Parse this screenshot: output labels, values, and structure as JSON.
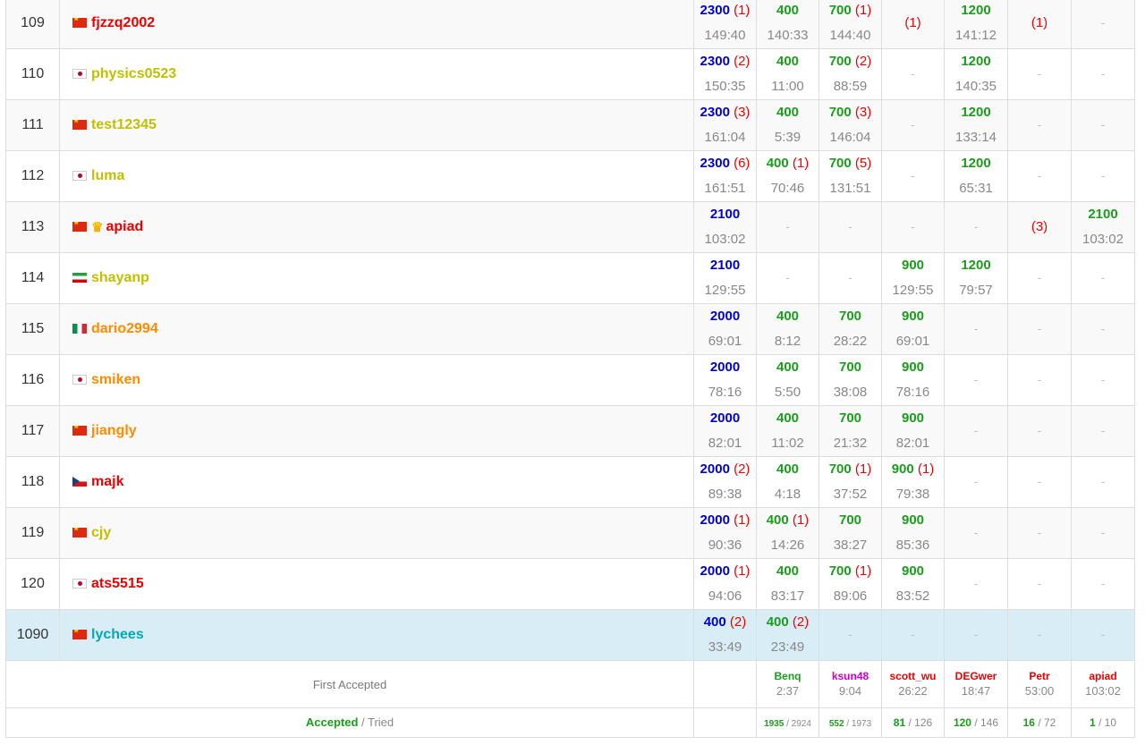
{
  "rows": [
    {
      "rank": "109",
      "flag": "cn",
      "crown": false,
      "user": "fjzzq2002",
      "color": "red",
      "score": "2300",
      "score_pen": "(1)",
      "time": "149:40",
      "tasks": [
        {
          "pts": "400",
          "pen": "",
          "time": "140:33"
        },
        {
          "pts": "700",
          "pen": "(1)",
          "time": "144:40"
        },
        {
          "pts": "",
          "pen": "(1)",
          "time": ""
        },
        {
          "pts": "1200",
          "pen": "",
          "time": "141:12"
        },
        {
          "pts": "",
          "pen": "(1)",
          "time": ""
        },
        {
          "pts": "-",
          "pen": "",
          "time": ""
        }
      ]
    },
    {
      "rank": "110",
      "flag": "jp",
      "crown": false,
      "user": "physics0523",
      "color": "yellow",
      "score": "2300",
      "score_pen": "(2)",
      "time": "150:35",
      "tasks": [
        {
          "pts": "400",
          "pen": "",
          "time": "11:00"
        },
        {
          "pts": "700",
          "pen": "(2)",
          "time": "88:59"
        },
        {
          "pts": "-",
          "pen": "",
          "time": ""
        },
        {
          "pts": "1200",
          "pen": "",
          "time": "140:35"
        },
        {
          "pts": "-",
          "pen": "",
          "time": ""
        },
        {
          "pts": "-",
          "pen": "",
          "time": ""
        }
      ]
    },
    {
      "rank": "111",
      "flag": "cn",
      "crown": false,
      "user": "test12345",
      "color": "yellow",
      "score": "2300",
      "score_pen": "(3)",
      "time": "161:04",
      "tasks": [
        {
          "pts": "400",
          "pen": "",
          "time": "5:39"
        },
        {
          "pts": "700",
          "pen": "(3)",
          "time": "146:04"
        },
        {
          "pts": "-",
          "pen": "",
          "time": ""
        },
        {
          "pts": "1200",
          "pen": "",
          "time": "133:14"
        },
        {
          "pts": "-",
          "pen": "",
          "time": ""
        },
        {
          "pts": "-",
          "pen": "",
          "time": ""
        }
      ]
    },
    {
      "rank": "112",
      "flag": "jp",
      "crown": false,
      "user": "luma",
      "color": "yellow",
      "score": "2300",
      "score_pen": "(6)",
      "time": "161:51",
      "tasks": [
        {
          "pts": "400",
          "pen": "(1)",
          "time": "70:46"
        },
        {
          "pts": "700",
          "pen": "(5)",
          "time": "131:51"
        },
        {
          "pts": "-",
          "pen": "",
          "time": ""
        },
        {
          "pts": "1200",
          "pen": "",
          "time": "65:31"
        },
        {
          "pts": "-",
          "pen": "",
          "time": ""
        },
        {
          "pts": "-",
          "pen": "",
          "time": ""
        }
      ]
    },
    {
      "rank": "113",
      "flag": "cn",
      "crown": true,
      "user": "apiad",
      "color": "red",
      "score": "2100",
      "score_pen": "",
      "time": "103:02",
      "tasks": [
        {
          "pts": "-",
          "pen": "",
          "time": ""
        },
        {
          "pts": "-",
          "pen": "",
          "time": ""
        },
        {
          "pts": "-",
          "pen": "",
          "time": ""
        },
        {
          "pts": "-",
          "pen": "",
          "time": ""
        },
        {
          "pts": "",
          "pen": "(3)",
          "time": ""
        },
        {
          "pts": "2100",
          "pen": "",
          "time": "103:02"
        }
      ]
    },
    {
      "rank": "114",
      "flag": "ir",
      "crown": false,
      "user": "shayanp",
      "color": "yellow",
      "score": "2100",
      "score_pen": "",
      "time": "129:55",
      "tasks": [
        {
          "pts": "-",
          "pen": "",
          "time": ""
        },
        {
          "pts": "-",
          "pen": "",
          "time": ""
        },
        {
          "pts": "900",
          "pen": "",
          "time": "129:55"
        },
        {
          "pts": "1200",
          "pen": "",
          "time": "79:57"
        },
        {
          "pts": "-",
          "pen": "",
          "time": ""
        },
        {
          "pts": "-",
          "pen": "",
          "time": ""
        }
      ]
    },
    {
      "rank": "115",
      "flag": "it",
      "crown": false,
      "user": "dario2994",
      "color": "orange",
      "score": "2000",
      "score_pen": "",
      "time": "69:01",
      "tasks": [
        {
          "pts": "400",
          "pen": "",
          "time": "8:12"
        },
        {
          "pts": "700",
          "pen": "",
          "time": "28:22"
        },
        {
          "pts": "900",
          "pen": "",
          "time": "69:01"
        },
        {
          "pts": "-",
          "pen": "",
          "time": ""
        },
        {
          "pts": "-",
          "pen": "",
          "time": ""
        },
        {
          "pts": "-",
          "pen": "",
          "time": ""
        }
      ]
    },
    {
      "rank": "116",
      "flag": "jp",
      "crown": false,
      "user": "smiken",
      "color": "orange",
      "score": "2000",
      "score_pen": "",
      "time": "78:16",
      "tasks": [
        {
          "pts": "400",
          "pen": "",
          "time": "5:50"
        },
        {
          "pts": "700",
          "pen": "",
          "time": "38:08"
        },
        {
          "pts": "900",
          "pen": "",
          "time": "78:16"
        },
        {
          "pts": "-",
          "pen": "",
          "time": ""
        },
        {
          "pts": "-",
          "pen": "",
          "time": ""
        },
        {
          "pts": "-",
          "pen": "",
          "time": ""
        }
      ]
    },
    {
      "rank": "117",
      "flag": "cn",
      "crown": false,
      "user": "jiangly",
      "color": "orange",
      "score": "2000",
      "score_pen": "",
      "time": "82:01",
      "tasks": [
        {
          "pts": "400",
          "pen": "",
          "time": "11:02"
        },
        {
          "pts": "700",
          "pen": "",
          "time": "21:32"
        },
        {
          "pts": "900",
          "pen": "",
          "time": "82:01"
        },
        {
          "pts": "-",
          "pen": "",
          "time": ""
        },
        {
          "pts": "-",
          "pen": "",
          "time": ""
        },
        {
          "pts": "-",
          "pen": "",
          "time": ""
        }
      ]
    },
    {
      "rank": "118",
      "flag": "cz",
      "crown": false,
      "user": "majk",
      "color": "red",
      "score": "2000",
      "score_pen": "(2)",
      "time": "89:38",
      "tasks": [
        {
          "pts": "400",
          "pen": "",
          "time": "4:18"
        },
        {
          "pts": "700",
          "pen": "(1)",
          "time": "37:52"
        },
        {
          "pts": "900",
          "pen": "(1)",
          "time": "79:38"
        },
        {
          "pts": "-",
          "pen": "",
          "time": ""
        },
        {
          "pts": "-",
          "pen": "",
          "time": ""
        },
        {
          "pts": "-",
          "pen": "",
          "time": ""
        }
      ]
    },
    {
      "rank": "119",
      "flag": "cn",
      "crown": false,
      "user": "cjy",
      "color": "yellow",
      "score": "2000",
      "score_pen": "(1)",
      "time": "90:36",
      "tasks": [
        {
          "pts": "400",
          "pen": "(1)",
          "time": "14:26"
        },
        {
          "pts": "700",
          "pen": "",
          "time": "38:27"
        },
        {
          "pts": "900",
          "pen": "",
          "time": "85:36"
        },
        {
          "pts": "-",
          "pen": "",
          "time": ""
        },
        {
          "pts": "-",
          "pen": "",
          "time": ""
        },
        {
          "pts": "-",
          "pen": "",
          "time": ""
        }
      ]
    },
    {
      "rank": "120",
      "flag": "jp",
      "crown": false,
      "user": "ats5515",
      "color": "red",
      "score": "2000",
      "score_pen": "(1)",
      "time": "94:06",
      "tasks": [
        {
          "pts": "400",
          "pen": "",
          "time": "83:17"
        },
        {
          "pts": "700",
          "pen": "(1)",
          "time": "89:06"
        },
        {
          "pts": "900",
          "pen": "",
          "time": "83:52"
        },
        {
          "pts": "-",
          "pen": "",
          "time": ""
        },
        {
          "pts": "-",
          "pen": "",
          "time": ""
        },
        {
          "pts": "-",
          "pen": "",
          "time": ""
        }
      ]
    },
    {
      "rank": "1090",
      "flag": "cn",
      "crown": false,
      "user": "lychees",
      "color": "cyan",
      "self": true,
      "score": "400",
      "score_pen": "(2)",
      "time": "33:49",
      "tasks": [
        {
          "pts": "400",
          "pen": "(2)",
          "time": "23:49"
        },
        {
          "pts": "-",
          "pen": "",
          "time": ""
        },
        {
          "pts": "-",
          "pen": "",
          "time": ""
        },
        {
          "pts": "-",
          "pen": "",
          "time": ""
        },
        {
          "pts": "-",
          "pen": "",
          "time": ""
        },
        {
          "pts": "-",
          "pen": "",
          "time": ""
        }
      ]
    }
  ],
  "first_accepted": {
    "label": "First Accepted",
    "items": [
      {
        "name": "Benq",
        "color": "green",
        "time": "2:37"
      },
      {
        "name": "ksun48",
        "color": "violet",
        "time": "9:04"
      },
      {
        "name": "scott_wu",
        "color": "red",
        "time": "26:22"
      },
      {
        "name": "DEGwer",
        "color": "red",
        "time": "18:47"
      },
      {
        "name": "Petr",
        "color": "red",
        "time": "53:00"
      },
      {
        "name": "apiad",
        "color": "red",
        "time": "103:02"
      }
    ]
  },
  "accepted_tried": {
    "label_accepted": "Accepted",
    "label_sep": " / ",
    "label_tried": "Tried",
    "items": [
      {
        "accepted": "1935",
        "tried": "2924"
      },
      {
        "accepted": "552",
        "tried": "1973"
      },
      {
        "accepted": "81",
        "tried": "126"
      },
      {
        "accepted": "120",
        "tried": "146"
      },
      {
        "accepted": "16",
        "tried": "72"
      },
      {
        "accepted": "1",
        "tried": "10"
      }
    ]
  },
  "colors": {
    "accepted": "#1a9d1a",
    "penalty": "#ee0000",
    "score": "#0000cc",
    "self_row": "#d9edf7"
  }
}
